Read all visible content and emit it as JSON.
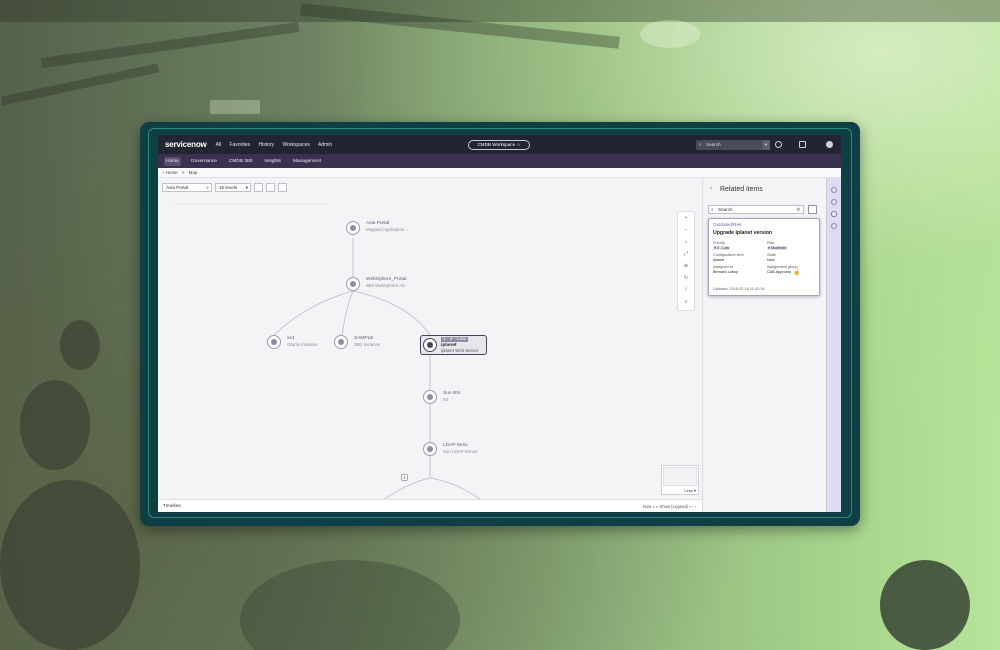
{
  "brand": {
    "logo": "servicenow"
  },
  "top_nav": [
    "All",
    "Favorites",
    "History",
    "Workspaces",
    "Admin"
  ],
  "workspace_pill": "CMDB Workspace ☆",
  "global_search": {
    "placeholder": "Search"
  },
  "sub_nav": {
    "items": [
      "Home",
      "Governance",
      "CMDB 360",
      "Insights",
      "Management"
    ],
    "active": "Home"
  },
  "breadcrumb": {
    "home": "Home",
    "sep": ">",
    "current": "Map"
  },
  "map_toolbar": {
    "ci_select": "Asia Portal",
    "levels_select": "15 levels"
  },
  "nodes": {
    "asia_portal": {
      "name": "Asia Portal",
      "sub": "Mapped Application..."
    },
    "websphere": {
      "name": "WebSphere_Portal",
      "sub": "IBM WebSphere AS"
    },
    "xe": {
      "name": "xe1",
      "sub": "Oracle Instance"
    },
    "sample": {
      "name": "SAMPLE",
      "sub": "DB2 Instance"
    },
    "iplanet": {
      "tag": "1 - 4 - Low",
      "name": "iplanet",
      "sub": "iplanet Web Server"
    },
    "sun_ies": {
      "name": "Sun IES",
      "sub": "IIS"
    },
    "ldap": {
      "name": "LDAP Serix",
      "sub": "Sun LDAP Server"
    }
  },
  "edge_badge": "4",
  "zoom_controls": [
    "+",
    "−",
    "⌂",
    "⤢",
    "⊕",
    "↻",
    "⁄",
    "⋎"
  ],
  "minimap": {
    "label": "Less ▾"
  },
  "timeline": {
    "label": "Timeline",
    "now": "Now",
    "range": "Show (Legend) ▾"
  },
  "related": {
    "title": "Related items",
    "search_placeholder": "Search",
    "card": {
      "kind": "Outdated/Res",
      "heading": "Upgrade iplanet version",
      "priority_label": "Priority",
      "priority_value": "● 4 - Low",
      "risk_label": "Risk",
      "risk_value": "● Moderate",
      "config_label": "Configuration item",
      "config_value": "iplanet",
      "state_label": "State",
      "state_value": "New",
      "assigned_label": "Assigned to",
      "assigned_value": "Bernard Laboy",
      "group_label": "Assignment group",
      "group_value": "CAB Approval",
      "updated": "Updated: 2018-02-19 11:02:18"
    }
  }
}
